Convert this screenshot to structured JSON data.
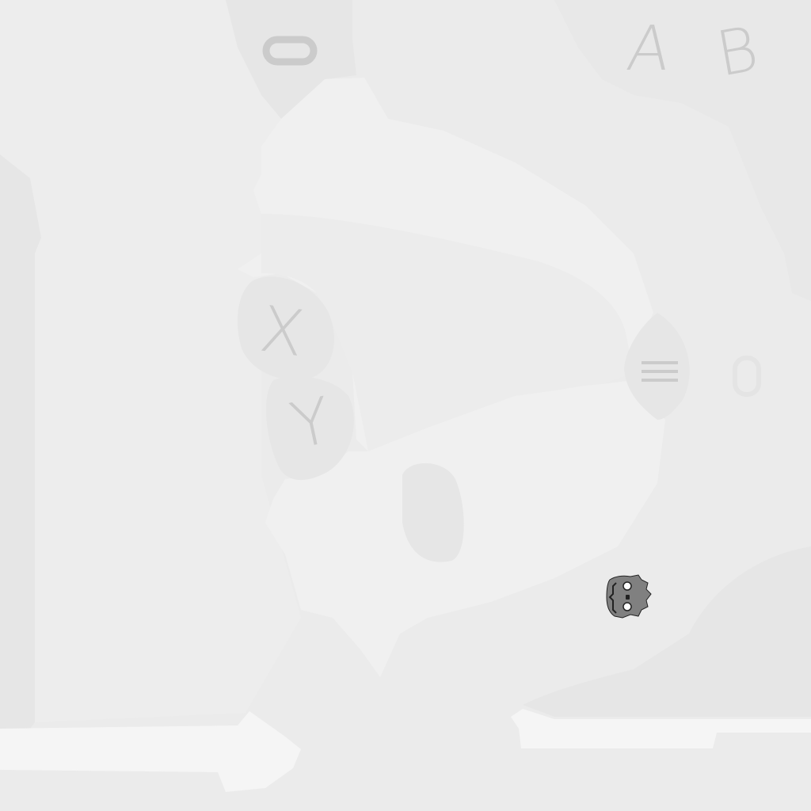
{
  "controller_map": {
    "colors": {
      "background": "#ebebeb",
      "body_light": "#f0f0f0",
      "body_mid": "#ededed",
      "button_fill": "#e6e6e6",
      "glyph": "#cbcbcb",
      "bottom_strip": "#f5f5f5",
      "godot_logo": "#808080"
    },
    "face_buttons": {
      "a": {
        "label": "A",
        "icon": "a-button"
      },
      "b": {
        "label": "B",
        "icon": "b-button"
      },
      "x": {
        "label": "X",
        "icon": "x-button"
      },
      "y": {
        "label": "Y",
        "icon": "y-button"
      }
    },
    "system_buttons": {
      "oculus": {
        "icon": "oculus-button-icon"
      },
      "menu": {
        "icon": "menu-icon"
      },
      "right_indicator": {
        "icon": "zero-shaped-indicator-icon"
      }
    },
    "logo": {
      "icon": "godot-robot-icon"
    }
  }
}
